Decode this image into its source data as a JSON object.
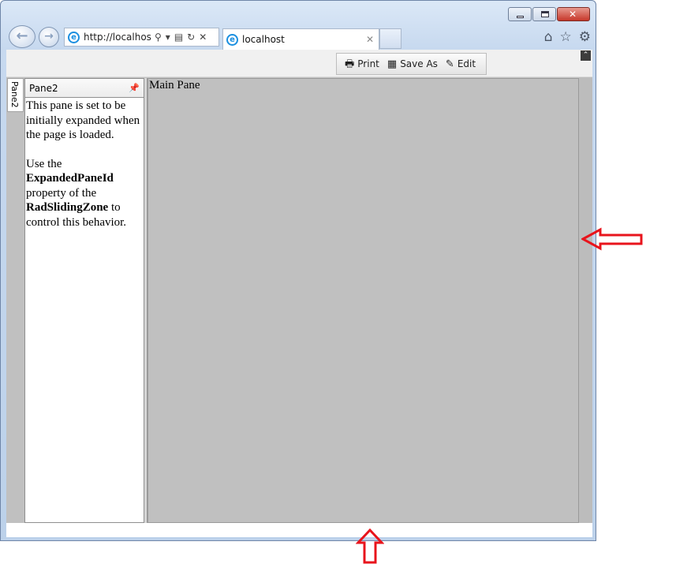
{
  "browser": {
    "address_url": "http://localhost:",
    "tab_title": "localhost",
    "address_icons": [
      "search-icon",
      "dropdown-icon",
      "compatibility-icon",
      "refresh-icon",
      "stop-icon"
    ],
    "right_icons": [
      "home-icon",
      "favorites-icon",
      "tools-icon"
    ]
  },
  "toolbar": {
    "print_label": "Print",
    "save_as_label": "Save As",
    "edit_label": "Edit"
  },
  "sliding_zone": {
    "tab_label": "Pane2"
  },
  "pane2": {
    "title": "Pane2",
    "para1": "This pane is set to be initially expanded when the page is loaded.",
    "para2_prefix": "Use the ",
    "para2_bold1": "ExpandedPaneId",
    "para2_mid": " property of the ",
    "para2_bold2": "RadSlidingZone",
    "para2_suffix": " to control this behavior."
  },
  "main_pane": {
    "label": "Main Pane"
  },
  "colors": {
    "pane_background": "#c0c0c0",
    "annotation_arrow": "#e8141c"
  }
}
